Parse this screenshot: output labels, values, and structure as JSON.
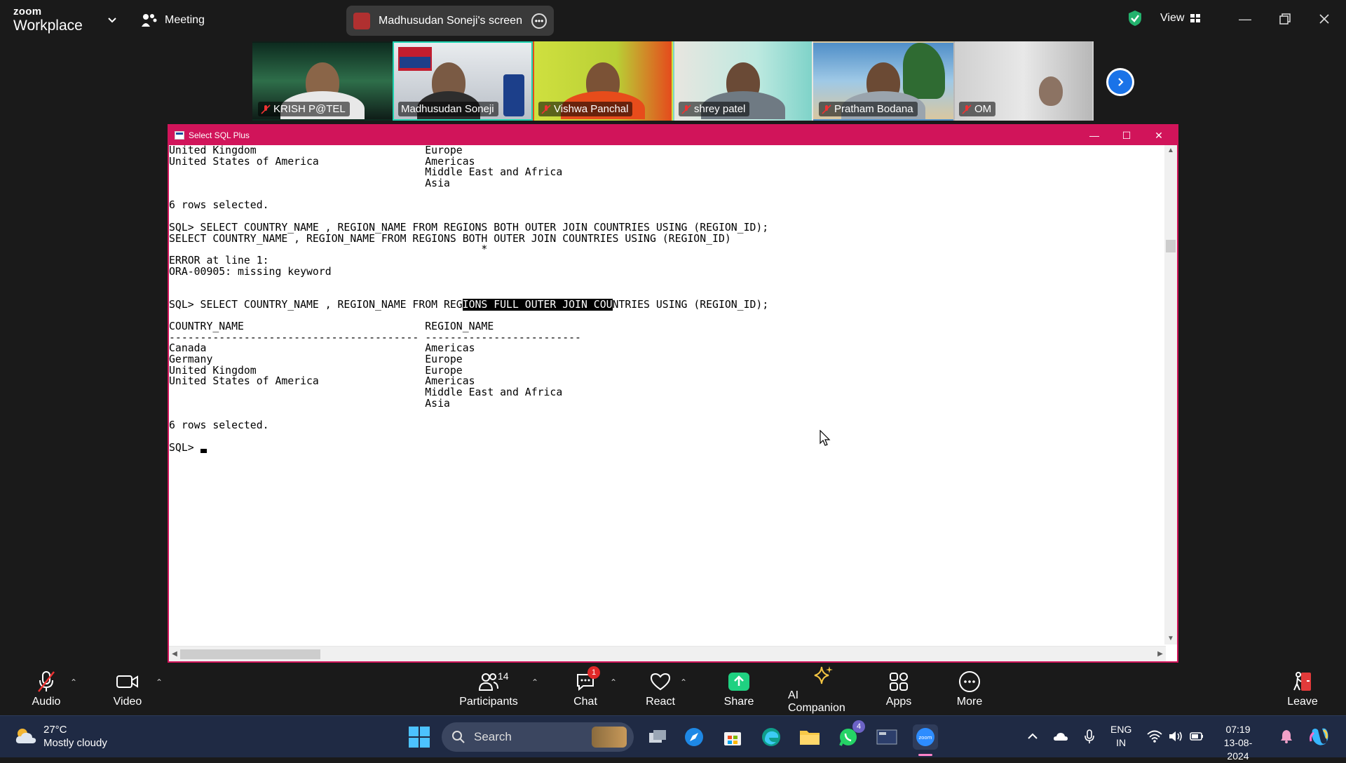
{
  "zoom": {
    "brand_small": "zoom",
    "brand_big": "Workplace",
    "meeting_label": "Meeting",
    "share_label": "Madhusudan Soneji's screen",
    "view_label": "View"
  },
  "participants": [
    {
      "name": "KRISH P@TEL",
      "muted": true,
      "bg": "#1b3b2e",
      "active": false
    },
    {
      "name": "Madhusudan Soneji",
      "muted": false,
      "bg": "#c9ccd1",
      "active": true
    },
    {
      "name": "Vishwa Panchal",
      "muted": true,
      "bg": "#c6d83a",
      "active": false
    },
    {
      "name": "shrey patel",
      "muted": true,
      "bg": "#8fd6cc",
      "active": false
    },
    {
      "name": "Pratham Bodana",
      "muted": true,
      "bg": "#6aa7d6",
      "active": false
    },
    {
      "name": "OM",
      "muted": true,
      "bg": "#bdbdbd",
      "active": false
    }
  ],
  "sqlplus": {
    "title": "Select SQL Plus",
    "lines": [
      "United Kingdom                           Europe",
      "United States of America                 Americas",
      "                                         Middle East and Africa",
      "                                         Asia",
      "",
      "6 rows selected.",
      "",
      "SQL> SELECT COUNTRY_NAME , REGION_NAME FROM REGIONS BOTH OUTER JOIN COUNTRIES USING (REGION_ID);",
      "SELECT COUNTRY_NAME , REGION_NAME FROM REGIONS BOTH OUTER JOIN COUNTRIES USING (REGION_ID)",
      "                                                  *",
      "ERROR at line 1:",
      "ORA-00905: missing keyword",
      "",
      "",
      "SQL> SELECT COUNTRY_NAME , REGION_NAME FROM REGIONS FULL OUTER JOIN COUNTRIES USING (REGION_ID);",
      "",
      "COUNTRY_NAME                             REGION_NAME",
      "---------------------------------------- -------------------------",
      "Canada                                   Americas",
      "Germany                                  Europe",
      "United Kingdom                           Europe",
      "United States of America                 Americas",
      "                                         Middle East and Africa",
      "                                         Asia",
      "",
      "6 rows selected.",
      "",
      "SQL> "
    ],
    "highlight": {
      "line": 14,
      "text": "IONS FULL OUTER JOIN COU"
    }
  },
  "toolbar": {
    "audio": "Audio",
    "video": "Video",
    "participants": "Participants",
    "participants_count": "14",
    "chat": "Chat",
    "chat_badge": "1",
    "react": "React",
    "share": "Share",
    "ai_companion": "AI Companion",
    "apps": "Apps",
    "more": "More",
    "leave": "Leave"
  },
  "taskbar": {
    "temperature": "27°C",
    "weather": "Mostly cloudy",
    "search_placeholder": "Search",
    "whatsapp_badge": "4",
    "lang_top": "ENG",
    "lang_bottom": "IN",
    "time": "07:19",
    "date": "13-08-2024"
  }
}
